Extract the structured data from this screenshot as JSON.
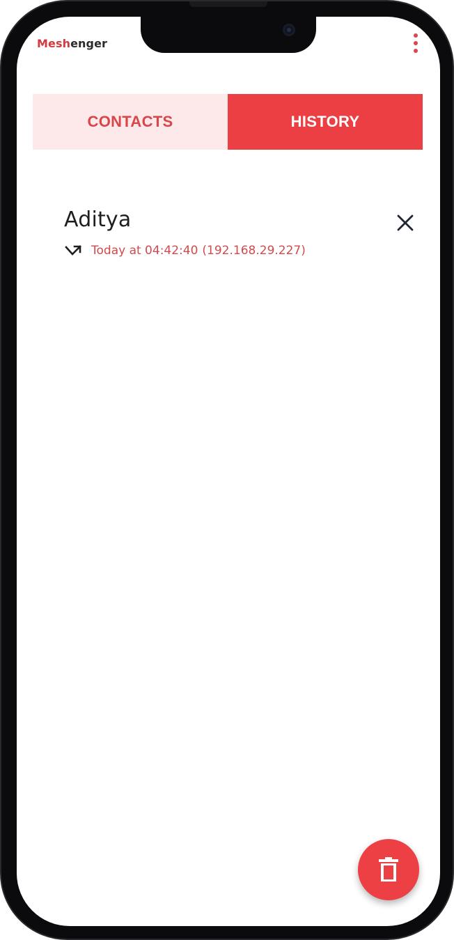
{
  "app": {
    "title_part1": "Mesh",
    "title_part2": "enger",
    "menu_icon": "more-vertical-icon"
  },
  "tabs": [
    {
      "label": "CONTACTS",
      "selected": false
    },
    {
      "label": "HISTORY",
      "selected": true
    }
  ],
  "history": [
    {
      "name": "Aditya",
      "direction_icon": "call-missed-icon",
      "time": "Today at 04:42:40",
      "address": "(192.168.29.227)",
      "remove_icon": "close-icon"
    }
  ],
  "fab": {
    "icon": "trash-icon",
    "color": "#ec4044"
  },
  "colors": {
    "accent": "#ec3f43",
    "tab_inactive_bg": "#fde9e9",
    "tab_inactive_text": "#d8454a",
    "meta_text": "#d24a4e"
  }
}
